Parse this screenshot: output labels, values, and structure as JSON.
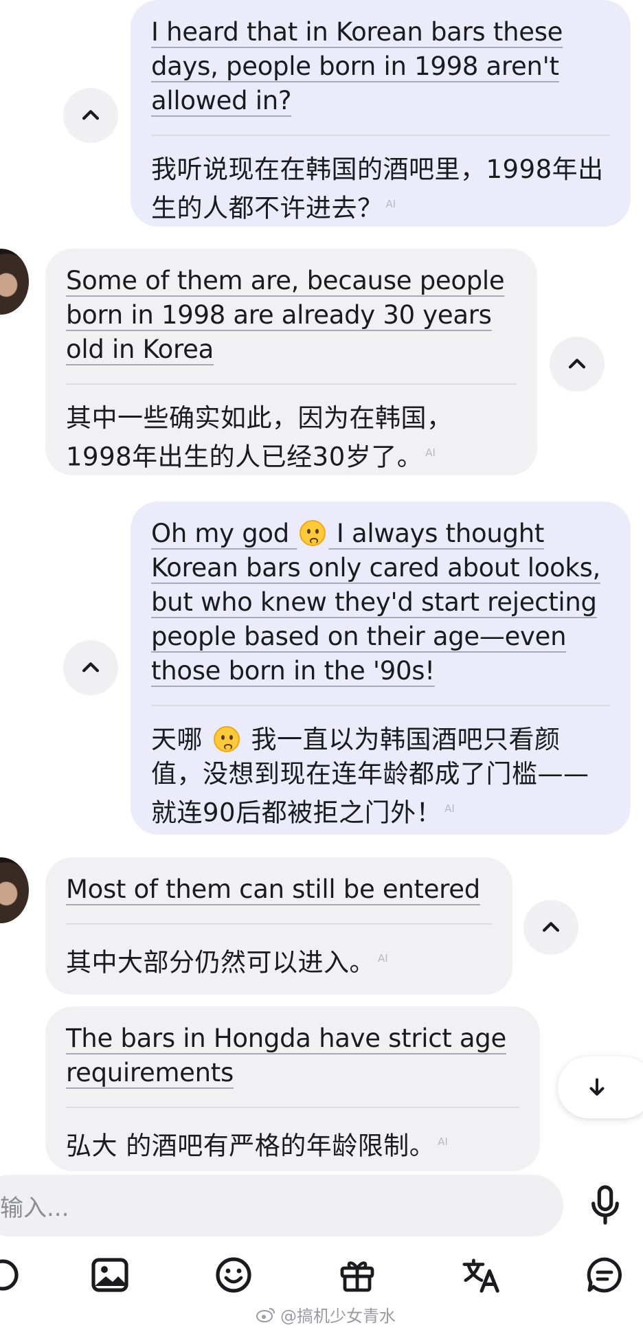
{
  "messages": [
    {
      "id": "m1",
      "role": "user",
      "text_en": "I heard that in Korean bars these days, people born in 1998 aren't allowed in?",
      "text_zh": "我听说现在在韩国的酒吧里，1998年出生的人都不许进去？",
      "ai_tag": "AI"
    },
    {
      "id": "m2",
      "role": "assistant",
      "text_en": "Some of them are, because people born in 1998 are already 30 years old in Korea",
      "text_zh": "其中一些确实如此，因为在韩国，1998年出生的人已经30岁了。",
      "ai_tag": "AI"
    },
    {
      "id": "m3",
      "role": "user",
      "text_en_a": "Oh my god",
      "text_en_b": "I always thought Korean bars only cared about looks, but who knew they'd start rejecting people based on their age—even those born in the '90s!",
      "text_zh_a": "天哪",
      "text_zh_b": "我一直以为韩国酒吧只看颜值，没想到现在连年龄都成了门槛——就连90后都被拒之门外！",
      "emoji": "worried-face",
      "ai_tag": "AI"
    },
    {
      "id": "m4",
      "role": "assistant",
      "text_en": "Most of them can still be entered",
      "text_zh": "其中大部分仍然可以进入。",
      "ai_tag": "AI"
    },
    {
      "id": "m5",
      "role": "assistant",
      "text_en": "The bars in Hongda have strict age requirements",
      "text_zh": "弘大 的酒吧有严格的年龄限制。",
      "ai_tag": "AI"
    }
  ],
  "input": {
    "placeholder": "输入..."
  },
  "toolbar": {
    "icons": [
      "image-icon",
      "emoji-icon",
      "gift-icon",
      "translate-icon",
      "chat-icon"
    ]
  },
  "watermark": {
    "text": "@搞机少女青水"
  },
  "colors": {
    "user_bubble": "#ecebfa",
    "assistant_bubble": "#f1f1f3",
    "text": "#1b1b1f"
  }
}
